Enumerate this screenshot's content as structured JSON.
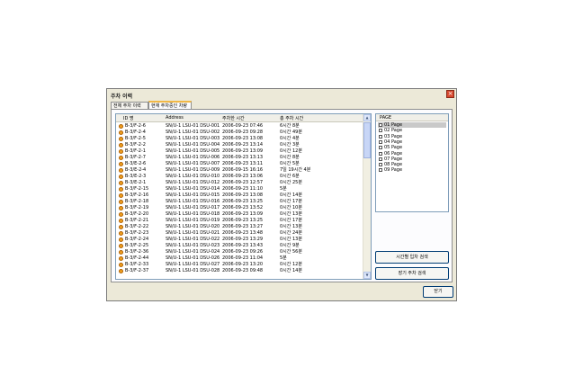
{
  "window": {
    "title": "주차 이력",
    "close_glyph": "×"
  },
  "tabs": [
    {
      "label": "전체 주차 이력"
    },
    {
      "label": "현재 주차중인 차량"
    }
  ],
  "list": {
    "columns": [
      "ID 명",
      "Address",
      "주차한 시간",
      "총 주차 시간"
    ],
    "rows": [
      [
        "B-3/F-2-6",
        "SN/U-1 LSU-01 DSU-001",
        "2006-09-23 07:46",
        "6시간 8분"
      ],
      [
        "B-3/F-2-4",
        "SN/U-1 LSU-01 DSU-002",
        "2006-09-23 09:28",
        "0시간 49분"
      ],
      [
        "B-3/F-2-5",
        "SN/U-1 LSU-01 DSU-003",
        "2006-09-23 13:08",
        "0시간 4분"
      ],
      [
        "B-3/F-2-2",
        "SN/U-1 LSU-01 DSU-004",
        "2006-09-23 13:14",
        "0시간 3분"
      ],
      [
        "B-3/F-2-1",
        "SN/U-1 LSU-01 DSU-005",
        "2006-09-23 13:09",
        "0시간 12분"
      ],
      [
        "B-3/F-2-7",
        "SN/U-1 LSU-01 DSU-006",
        "2006-09-23 13:13",
        "0시간 8분"
      ],
      [
        "B-3/E-2-6",
        "SN/U-1 LSU-01 DSU-007",
        "2006-09-23 13:11",
        "0시간 5분"
      ],
      [
        "B-3/E-2-4",
        "SN/U-1 LSU-01 DSU-009",
        "2006-09-15 16:16",
        "7일 19시간 4분"
      ],
      [
        "B-3/E-2-3",
        "SN/U-1 LSU-01 DSU-010",
        "2006-09-23 13:06",
        "0시간 6분"
      ],
      [
        "B-3/E-2-1",
        "SN/U-1 LSU-01 DSU-012",
        "2006-09-23 12:57",
        "0시간 25분"
      ],
      [
        "B-3/F-2-15",
        "SN/U-1 LSU-01 DSU-014",
        "2006-09-23 11:10",
        "5분"
      ],
      [
        "B-3/F-2-16",
        "SN/U-1 LSU-01 DSU-015",
        "2006-09-23 13:08",
        "0시간 14분"
      ],
      [
        "B-3/F-2-18",
        "SN/U-1 LSU-01 DSU-016",
        "2006-09-23 13:25",
        "0시간 17분"
      ],
      [
        "B-3/F-2-19",
        "SN/U-1 LSU-01 DSU-017",
        "2006-09-23 13:52",
        "0시간 10분"
      ],
      [
        "B-3/F-2-20",
        "SN/U-1 LSU-01 DSU-018",
        "2006-09-23 13:09",
        "0시간 13분"
      ],
      [
        "B-3/F-2-21",
        "SN/U-1 LSU-01 DSU-019",
        "2006-09-23 13:25",
        "0시간 17분"
      ],
      [
        "B-3/F-2-22",
        "SN/U-1 LSU-01 DSU-020",
        "2006-09-23 13:27",
        "0시간 13분"
      ],
      [
        "B-3/F-2-23",
        "SN/U-1 LSU-01 DSU-021",
        "2006-09-23 13:48",
        "0시간 24분"
      ],
      [
        "B-3/F-2-24",
        "SN/U-1 LSU-01 DSU-022",
        "2006-09-23 13:29",
        "0시간 13분"
      ],
      [
        "B-3/F-2-25",
        "SN/U-1 LSU-01 DSU-023",
        "2006-09-23 13:43",
        "0시간 9분"
      ],
      [
        "B-3/F-2-36",
        "SN/U-1 LSU-01 DSU-024",
        "2006-09-23 09:26",
        "0시간 56분"
      ],
      [
        "B-3/F-2-44",
        "SN/U-1 LSU-01 DSU-026",
        "2006-09-23 11:04",
        "5분"
      ],
      [
        "B-3/F-2-33",
        "SN/U-1 LSU-01 DSU-027",
        "2006-09-23 13:20",
        "0시간 12분"
      ],
      [
        "B-3/F-2-37",
        "SN/U-1 LSU-01 DSU-028",
        "2006-09-23 09:48",
        "0시간 14분"
      ]
    ]
  },
  "page_list": {
    "header": "PAGE",
    "items": [
      "01 Page",
      "02 Page",
      "03 Page",
      "04 Page",
      "05 Page",
      "06 Page",
      "07 Page",
      "08 Page",
      "09 Page"
    ],
    "selected_index": 0
  },
  "buttons": {
    "time_search": "시간별 입차 검색",
    "long_search": "장기 주차 검색",
    "close": "닫기"
  },
  "scroll": {
    "up": "▲",
    "down": "▼"
  }
}
